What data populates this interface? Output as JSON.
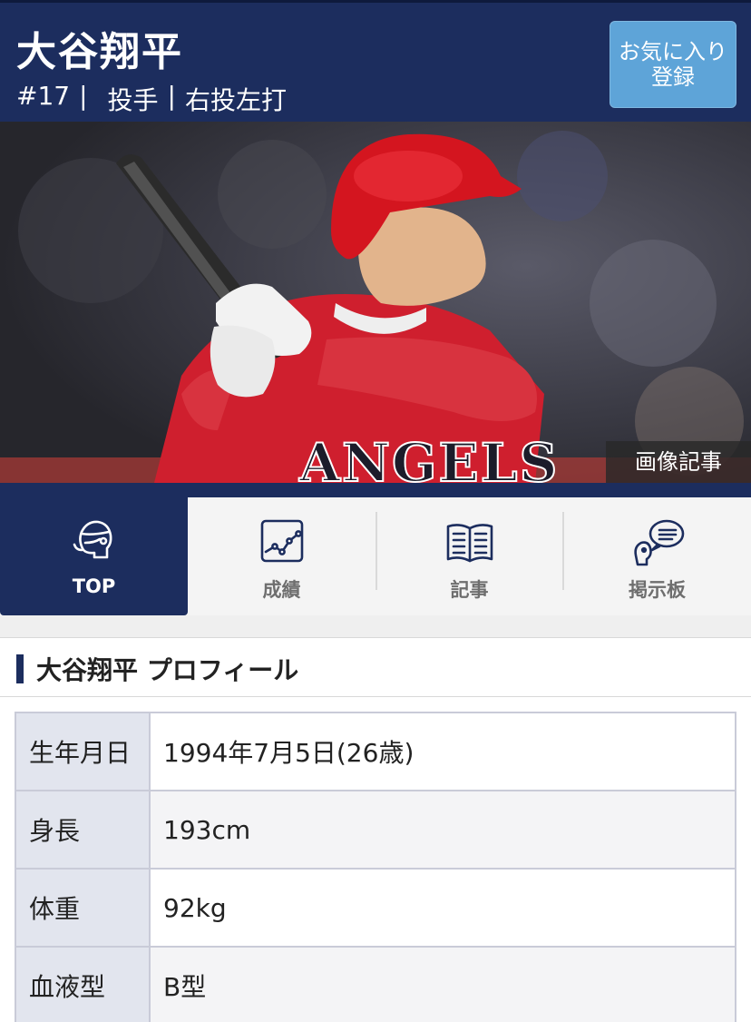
{
  "header": {
    "name": "大谷翔平",
    "number": "#17",
    "position": "投手",
    "bats_throws": "右投左打",
    "favorite_button": "お気に入り登録"
  },
  "photo": {
    "badge": "画像記事",
    "jersey_text": "ANGELS"
  },
  "tabs": [
    {
      "label": "TOP",
      "icon": "person-profile-icon",
      "active": true
    },
    {
      "label": "成績",
      "icon": "chart-line-icon",
      "active": false
    },
    {
      "label": "記事",
      "icon": "open-book-icon",
      "active": false
    },
    {
      "label": "掲示板",
      "icon": "speech-bubble-icon",
      "active": false
    }
  ],
  "profile": {
    "title": "大谷翔平 プロフィール",
    "rows": [
      {
        "key": "生年月日",
        "value": "1994年7月5日(26歳)"
      },
      {
        "key": "身長",
        "value": "193cm"
      },
      {
        "key": "体重",
        "value": "92kg"
      },
      {
        "key": "血液型",
        "value": "B型"
      }
    ]
  },
  "colors": {
    "navy": "#1c2d5e",
    "button_blue": "#5ea4d8",
    "angels_red": "#cf1f2e"
  }
}
